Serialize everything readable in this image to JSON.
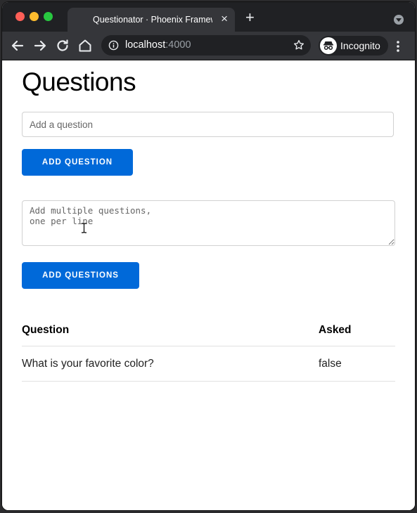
{
  "browser": {
    "tab_title": "Questionator · Phoenix Framework",
    "tab_close": "×",
    "new_tab": "+",
    "url_host": "localhost",
    "url_port": ":4000",
    "incognito_label": "Incognito"
  },
  "page": {
    "title": "Questions",
    "question_input": {
      "placeholder": "Add a question",
      "value": ""
    },
    "add_question_label": "ADD QUESTION",
    "questions_textarea": {
      "placeholder": "Add multiple questions,\none per line",
      "value": ""
    },
    "add_questions_label": "ADD QUESTIONS",
    "table": {
      "headers": [
        "Question",
        "Asked"
      ],
      "rows": [
        {
          "question": "What is your favorite color?",
          "asked": "false"
        }
      ]
    }
  },
  "colors": {
    "accent": "#0069d9",
    "tab_bar": "#202124",
    "toolbar": "#35363a"
  },
  "icons": [
    "back-icon",
    "forward-icon",
    "reload-icon",
    "home-icon",
    "info-icon",
    "star-icon",
    "incognito-icon",
    "kebab-menu-icon",
    "text-cursor-icon"
  ]
}
